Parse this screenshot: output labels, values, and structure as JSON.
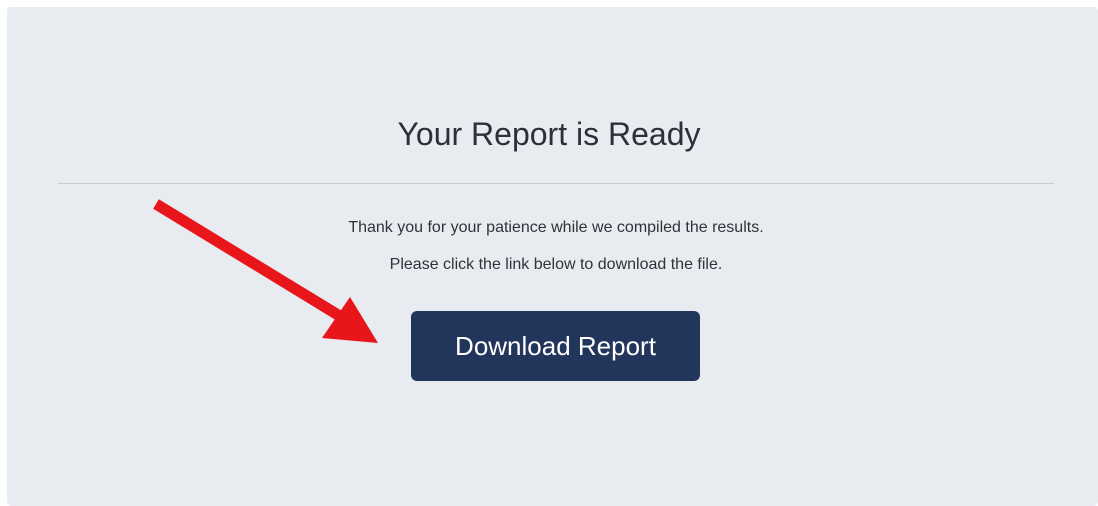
{
  "report": {
    "title": "Your Report is Ready",
    "message_line1": "Thank you for your patience while we compiled the results.",
    "message_line2": "Please click the link below to download the file.",
    "download_button_label": "Download Report"
  },
  "colors": {
    "panel_background": "#e8ebef",
    "button_background": "#22355b",
    "button_text": "#ffffff",
    "arrow": "#e8161a"
  },
  "annotation": {
    "arrow_icon": "red-pointer-arrow-icon"
  }
}
